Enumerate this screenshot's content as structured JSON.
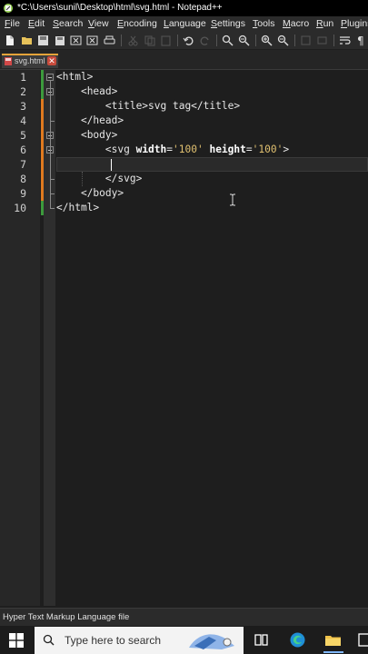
{
  "window": {
    "title": "*C:\\Users\\sunil\\Desktop\\html\\svg.html - Notepad++"
  },
  "menu": [
    "File",
    "Edit",
    "Search",
    "View",
    "Encoding",
    "Language",
    "Settings",
    "Tools",
    "Macro",
    "Run",
    "Plugins"
  ],
  "toolbar": {
    "icons": [
      "new-file-icon",
      "open-file-icon",
      "save-icon",
      "save-all-icon",
      "close-icon",
      "close-all-icon",
      "print-icon",
      "cut-icon",
      "copy-icon",
      "paste-icon",
      "undo-icon",
      "redo-icon",
      "find-icon",
      "replace-icon",
      "zoom-in-icon",
      "zoom-out-icon",
      "sync-vertical-icon",
      "sync-horizontal-icon",
      "word-wrap-icon",
      "show-all-chars-icon"
    ]
  },
  "tab": {
    "label": "svg.html",
    "close_glyph": "✕"
  },
  "editor": {
    "line_numbers": [
      "1",
      "2",
      "3",
      "4",
      "5",
      "6",
      "7",
      "8",
      "9",
      "10"
    ],
    "lines": [
      {
        "indent": "",
        "text": "<html>"
      },
      {
        "indent": "    ",
        "text": "<head>"
      },
      {
        "indent": "        ",
        "text": "<title>svg tag</title>"
      },
      {
        "indent": "    ",
        "text": "</head>"
      },
      {
        "indent": "    ",
        "text": "<body>"
      },
      {
        "indent": "        ",
        "text": "<svg width='100' height='100'>"
      },
      {
        "indent": "",
        "text": ""
      },
      {
        "indent": "        ",
        "text": "</svg>"
      },
      {
        "indent": "    ",
        "text": "</body>"
      },
      {
        "indent": "",
        "text": "</html>"
      }
    ],
    "line6_parts": {
      "open": "<svg ",
      "attr1": "width",
      "eq1": "=",
      "val1": "'100'",
      "sp": " ",
      "attr2": "height",
      "eq2": "=",
      "val2": "'100'",
      "close": ">"
    },
    "change_colors": {
      "saved": "#3c9b3c",
      "modified": "#e07a1f"
    }
  },
  "status": {
    "text": "Hyper Text Markup Language file"
  },
  "taskbar": {
    "search_placeholder": "Type here to search"
  }
}
